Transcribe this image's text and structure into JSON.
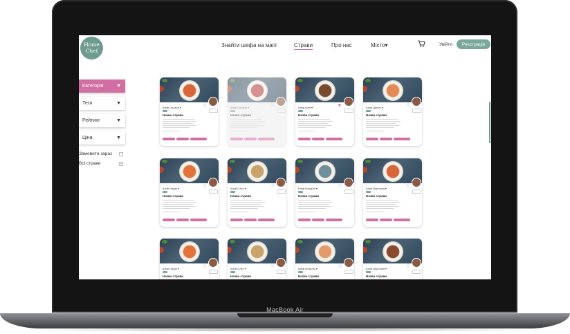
{
  "device": {
    "label": "MacBook Air"
  },
  "logo": {
    "line1": "Home",
    "line2": "Chef"
  },
  "nav": [
    {
      "label": "Знайти шефа на мапі"
    },
    {
      "label": "Страви",
      "active": true
    },
    {
      "label": "Про нас"
    },
    {
      "label": "Місто",
      "suffix": "▾"
    }
  ],
  "header": {
    "cart_icon": "cart-icon",
    "login": "Увійти",
    "register": "Реєстрація"
  },
  "filters": [
    {
      "label": "Категорія",
      "active": true
    },
    {
      "label": "Теги"
    },
    {
      "label": "Рейтинг"
    },
    {
      "label": "Ціна"
    }
  ],
  "checks": [
    {
      "label": "Замовити зараз",
      "checked": false
    },
    {
      "label": "Всі страви",
      "checked": true
    }
  ],
  "colors": {
    "accent_pink": "#d26fa2",
    "accent_green": "#7ba89d",
    "logo_green": "#6e9a8f"
  },
  "cards": [
    {
      "chef": "Шеф Оксана",
      "dish": "Назва страви",
      "dish_color": "#d9663a",
      "liked": false,
      "dimmed": false
    },
    {
      "chef": "Шеф Оксана",
      "dish": "Назва страви",
      "dish_color": "#b33a3a",
      "liked": false,
      "dimmed": true
    },
    {
      "chef": "Шеф Іван",
      "dish": "Назва страви",
      "dish_color": "#7a4a2e",
      "liked": true,
      "dimmed": false
    },
    {
      "chef": "Шеф Денис",
      "dish": "Назва страви",
      "dish_color": "#e48a55",
      "liked": false,
      "dimmed": false
    },
    {
      "chef": "Шеф Надія",
      "dish": "Назва страви",
      "dish_color": "#e3733d",
      "liked": false,
      "dimmed": false
    },
    {
      "chef": "Шеф Олег",
      "dish": "Назва страви",
      "dish_color": "#c9a36a",
      "liked": false,
      "dimmed": false
    },
    {
      "chef": "Шеф Назарій",
      "dish": "Назва страви",
      "dish_color": "#6e8f9c",
      "liked": false,
      "dimmed": false
    },
    {
      "chef": "Шеф Вероніка",
      "dish": "Назва страви",
      "dish_color": "#d9663a",
      "liked": false,
      "dimmed": false
    },
    {
      "chef": "Шеф Надія",
      "dish": "Назва страви",
      "dish_color": "#e3733d",
      "liked": false,
      "dimmed": false
    },
    {
      "chef": "Шеф Олег",
      "dish": "Назва страви",
      "dish_color": "#c9a36a",
      "liked": false,
      "dimmed": false
    },
    {
      "chef": "Шеф Наталія",
      "dish": "Назва страви",
      "dish_color": "#e69a6a",
      "liked": false,
      "dimmed": false
    },
    {
      "chef": "Шеф Вероніка",
      "dish": "Назва страви",
      "dish_color": "#8a4a2e",
      "liked": false,
      "dimmed": false
    }
  ]
}
